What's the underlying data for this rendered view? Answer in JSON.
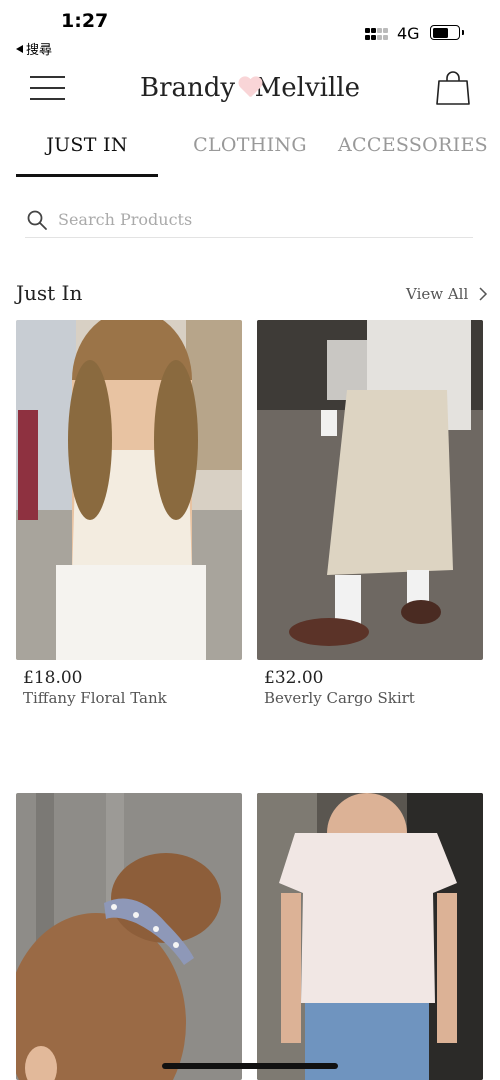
{
  "status_bar": {
    "time": "1:27",
    "back_app": "搜尋",
    "network": "4G",
    "battery_level": 0.62
  },
  "header": {
    "brand_left": "Brandy",
    "brand_right": "Melville",
    "menu_icon": "hamburger-menu-icon",
    "cart_icon": "shopping-bag-icon",
    "accent_color": "#f9d5d7"
  },
  "tabs": [
    {
      "label": "JUST IN",
      "active": true
    },
    {
      "label": "CLOTHING",
      "active": false
    },
    {
      "label": "ACCESSORIES",
      "active": false
    }
  ],
  "search": {
    "placeholder": "Search Products",
    "value": ""
  },
  "section": {
    "title": "Just In",
    "view_all": "View All"
  },
  "products": [
    {
      "price": "£18.00",
      "name": "Tiffany Floral Tank"
    },
    {
      "price": "£32.00",
      "name": "Beverly Cargo Skirt"
    },
    {
      "price": "",
      "name": ""
    },
    {
      "price": "",
      "name": ""
    }
  ]
}
